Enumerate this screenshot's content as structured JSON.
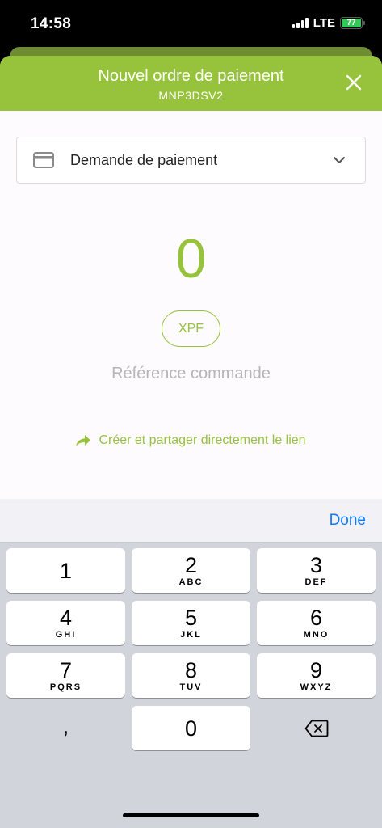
{
  "status_bar": {
    "time": "14:58",
    "network": "LTE",
    "battery": "77",
    "icons": [
      "signal-icon",
      "battery-icon"
    ]
  },
  "header": {
    "title": "Nouvel ordre de paiement",
    "subtitle": "MNP3DSV2",
    "close_icon": "close-icon"
  },
  "payment_type": {
    "selected": "Demande de paiement",
    "icon": "card-icon"
  },
  "amount": {
    "value": "0",
    "currency": "XPF"
  },
  "reference": {
    "placeholder": "Référence commande",
    "value": ""
  },
  "share": {
    "label": "Créer et partager directement le lien",
    "icon": "share-icon"
  },
  "keyboard": {
    "done_label": "Done",
    "keys": [
      {
        "digit": "1",
        "letters": ""
      },
      {
        "digit": "2",
        "letters": "ABC"
      },
      {
        "digit": "3",
        "letters": "DEF"
      },
      {
        "digit": "4",
        "letters": "GHI"
      },
      {
        "digit": "5",
        "letters": "JKL"
      },
      {
        "digit": "6",
        "letters": "MNO"
      },
      {
        "digit": "7",
        "letters": "PQRS"
      },
      {
        "digit": "8",
        "letters": "TUV"
      },
      {
        "digit": "9",
        "letters": "WXYZ"
      },
      {
        "digit": ",",
        "letters": ""
      },
      {
        "digit": "0",
        "letters": ""
      }
    ]
  },
  "colors": {
    "brand_green": "#97c23c",
    "ios_blue": "#0a7aff",
    "battery_green": "#34c759"
  }
}
